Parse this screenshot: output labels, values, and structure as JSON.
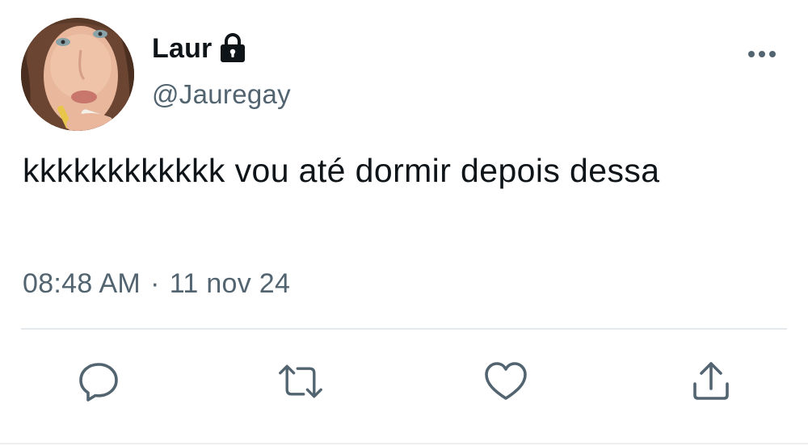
{
  "author": {
    "display_name": "Laur",
    "handle": "@Jauregay",
    "avatar_icon": "profile-photo",
    "protected_icon": "lock-icon"
  },
  "tweet": {
    "text": "kkkkkkkkkkkk vou até dormir depois dessa",
    "time": "08:48 AM",
    "separator": "·",
    "date": "11 nov 24"
  },
  "actions": {
    "reply_icon": "reply-icon",
    "retweet_icon": "retweet-icon",
    "like_icon": "heart-icon",
    "share_icon": "share-icon",
    "more_icon": "more-icon"
  },
  "colors": {
    "icon": "#536471",
    "text": "#0f1419",
    "divider": "#e6e9eb",
    "background": "#ffffff"
  }
}
